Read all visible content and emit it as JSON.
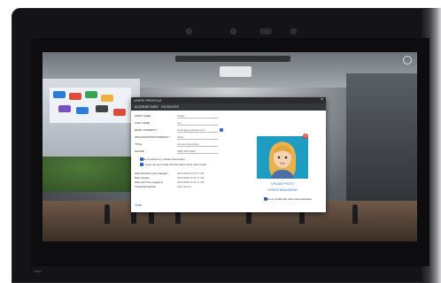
{
  "dialog": {
    "title": "USER PROFILE",
    "close_glyph": "×",
    "tabs": [
      {
        "label": "ACCOUNT INFO"
      },
      {
        "label": "PASSWORD"
      }
    ],
    "fields": [
      {
        "label": "FIRST NAME",
        "value": "Kristin"
      },
      {
        "label": "LAST NAME",
        "value": "Lee"
      },
      {
        "label": "EMAIL ADDRESS *",
        "value": "kristin@eventshub.com"
      },
      {
        "label": "ORGANIZATION/COMPANY *",
        "value": "Virtex"
      },
      {
        "label": "TITLE",
        "value": "Account Executive"
      },
      {
        "label": "PHONE",
        "value": "(555) 555-0199"
      }
    ],
    "checks": [
      {
        "label": "I want to share my contact information"
      },
      {
        "label": "Yes, keep me up to date with the latest news and events"
      }
    ],
    "meta": [
      {
        "label": "Date Password Last Changed",
        "value": "03/11/2020 02:31:17 AM"
      },
      {
        "label": "Date Created",
        "value": "03/11/2020 02:31:17 AM"
      },
      {
        "label": "Date Last Time Logged In",
        "value": "03/11/2020 02:31:17 AM"
      },
      {
        "label": "Credential Network",
        "value": "Virtex Events"
      }
    ],
    "close_label": "Close",
    "avatar": {
      "upload_label": "UPLOAD PHOTO",
      "make_label": "CREATE NEW AVATAR",
      "share_label": "Share my profile with other event attendees"
    }
  },
  "colors": {
    "accent": "#2a6fd0",
    "titlebar": "#2a2b2e",
    "avatar_bg": "#1f9cc2"
  },
  "laptop": {
    "brand": "Vizio"
  }
}
